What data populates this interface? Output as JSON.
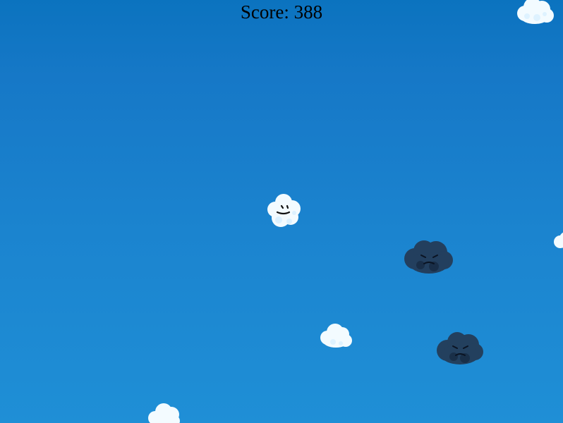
{
  "game": {
    "score_label": "Score: 388",
    "colors": {
      "sky_top": "#0b73bf",
      "sky_bottom": "#1f8fd6",
      "white_cloud": "#f3fbff",
      "white_cloud_shadow": "#d7efff",
      "storm_cloud": "#243a55",
      "storm_cloud_shadow": "#16283f",
      "face_ink": "#111111"
    },
    "sprites": {
      "player": "smiling-cloud-player",
      "storm_clouds": 2,
      "white_clouds": 4
    }
  }
}
